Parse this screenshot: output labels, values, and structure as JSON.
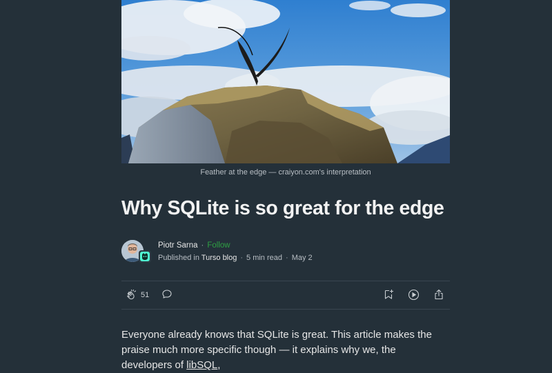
{
  "hero": {
    "alt": "Feather at the edge"
  },
  "caption": "Feather at the edge — craiyon.com's interpretation",
  "article": {
    "title": "Why SQLite is so great for the edge",
    "author": "Piotr Sarna",
    "follow_label": "Follow",
    "published_prefix": "Published in",
    "publication": "Turso blog",
    "read_time": "5 min read",
    "date": "May 2"
  },
  "actions": {
    "clap_count": "51"
  },
  "body": {
    "paragraph_start": "Everyone already knows that SQLite is great. This article makes the praise much more specific though — it explains why we, the developers of ",
    "link_text": "libSQL",
    "paragraph_end": ","
  },
  "colors": {
    "background": "#243039",
    "follow": "#2ea043"
  }
}
